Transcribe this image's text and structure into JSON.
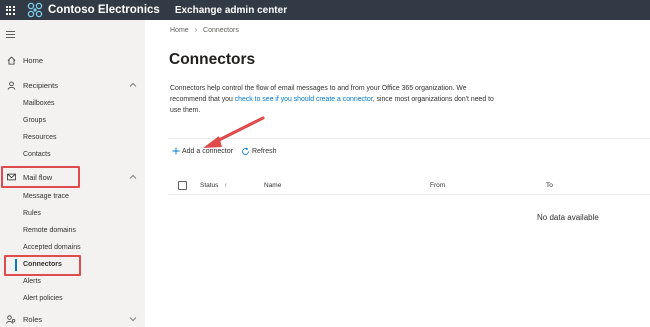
{
  "header": {
    "brand": "Contoso Electronics",
    "app_title": "Exchange admin center",
    "bg_color": "#323a45"
  },
  "sidebar": {
    "items": [
      {
        "label": "Home",
        "icon": "home-icon"
      },
      {
        "label": "Recipients",
        "icon": "person-icon"
      },
      {
        "label": "Mail flow",
        "icon": "mail-icon"
      },
      {
        "label": "Roles",
        "icon": "roles-icon"
      }
    ],
    "recipients_sub": [
      "Mailboxes",
      "Groups",
      "Resources",
      "Contacts"
    ],
    "mailflow_sub": [
      "Message trace",
      "Rules",
      "Remote domains",
      "Accepted domains",
      "Connectors",
      "Alerts",
      "Alert policies"
    ],
    "selected": "Connectors"
  },
  "main": {
    "breadcrumb": {
      "home": "Home",
      "current": "Connectors"
    },
    "title": "Connectors",
    "description": {
      "part1": "Connectors help control the flow of email messages to and from your Office 365 organization. We recommend that you ",
      "link": "check to see if you should create a connector",
      "part2": ", since most organizations don't need to use them."
    },
    "toolbar": {
      "add_label": "Add a connector",
      "refresh_label": "Refresh"
    },
    "table": {
      "columns": {
        "status": "Status",
        "sort": "↑",
        "name": "Name",
        "from": "From",
        "to": "To"
      },
      "empty_text": "No data available"
    }
  },
  "colors": {
    "accent": "#0078d4",
    "highlight": "#e04b4b",
    "sidebar_bg": "#f3f2f1"
  }
}
